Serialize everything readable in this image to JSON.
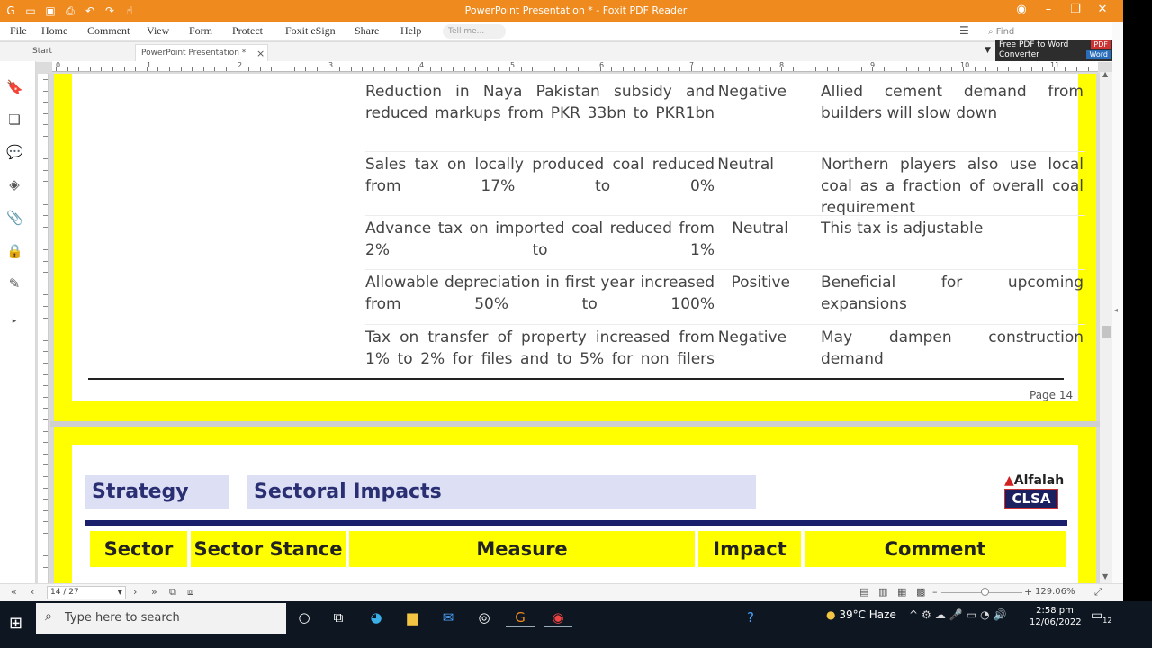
{
  "window": {
    "title": "PowerPoint Presentation * - Foxit PDF Reader"
  },
  "quick_access": [
    "foxit-logo-icon",
    "open-icon",
    "save-icon",
    "print-icon",
    "undo-icon",
    "redo-icon",
    "hand-icon"
  ],
  "menu": [
    "File",
    "Home",
    "Comment",
    "View",
    "Form",
    "Protect",
    "Foxit eSign",
    "Share",
    "Help"
  ],
  "tell_me": "Tell me...",
  "find": "Find",
  "tabs": {
    "start": "Start",
    "doc": "PowerPoint Presentation *",
    "close": "×"
  },
  "ad": {
    "line1": "Free PDF to Word",
    "line2": "Converter",
    "pdf": "PDF",
    "word": "Word"
  },
  "ruler": [
    "0",
    "1",
    "2",
    "3",
    "4",
    "5",
    "6",
    "7",
    "8",
    "9",
    "10",
    "11"
  ],
  "page14": {
    "rows": [
      {
        "measure": "Reduction in Naya Pakistan subsidy and reduced markups from PKR 33bn to PKR1bn",
        "impact": "Negative",
        "comment": "Allied cement demand from builders will slow down"
      },
      {
        "measure": "Sales tax on locally produced coal reduced from 17% to 0%",
        "impact": "Neutral",
        "comment": "Northern players also use local coal as a fraction of overall coal requirement"
      },
      {
        "measure": "Advance tax on imported coal reduced from 2% to 1%",
        "impact": "Neutral",
        "comment": "This tax is adjustable"
      },
      {
        "measure": "Allowable depreciation in first year increased from 50% to 100%",
        "impact": "Positive",
        "comment": "Beneficial for upcoming expansions"
      },
      {
        "measure": "Tax on transfer of property increased from 1% to 2% for files and to 5% for non filers",
        "impact": "Negative",
        "comment": "May dampen construction demand"
      }
    ],
    "page_label": "Page 14"
  },
  "page15": {
    "strategy": "Strategy",
    "sectoral": "Sectoral Impacts",
    "logo_top": "Alfalah",
    "logo_bottom": "CLSA",
    "headers": [
      "Sector",
      "Sector Stance",
      "Measure",
      "Impact",
      "Comment"
    ]
  },
  "status": {
    "page": "14 / 27",
    "zoom": "129.06%"
  },
  "taskbar": {
    "search_placeholder": "Type here to search",
    "weather": "39°C  Haze",
    "time": "2:58 pm",
    "date": "12/06/2022",
    "notif_count": "12"
  }
}
